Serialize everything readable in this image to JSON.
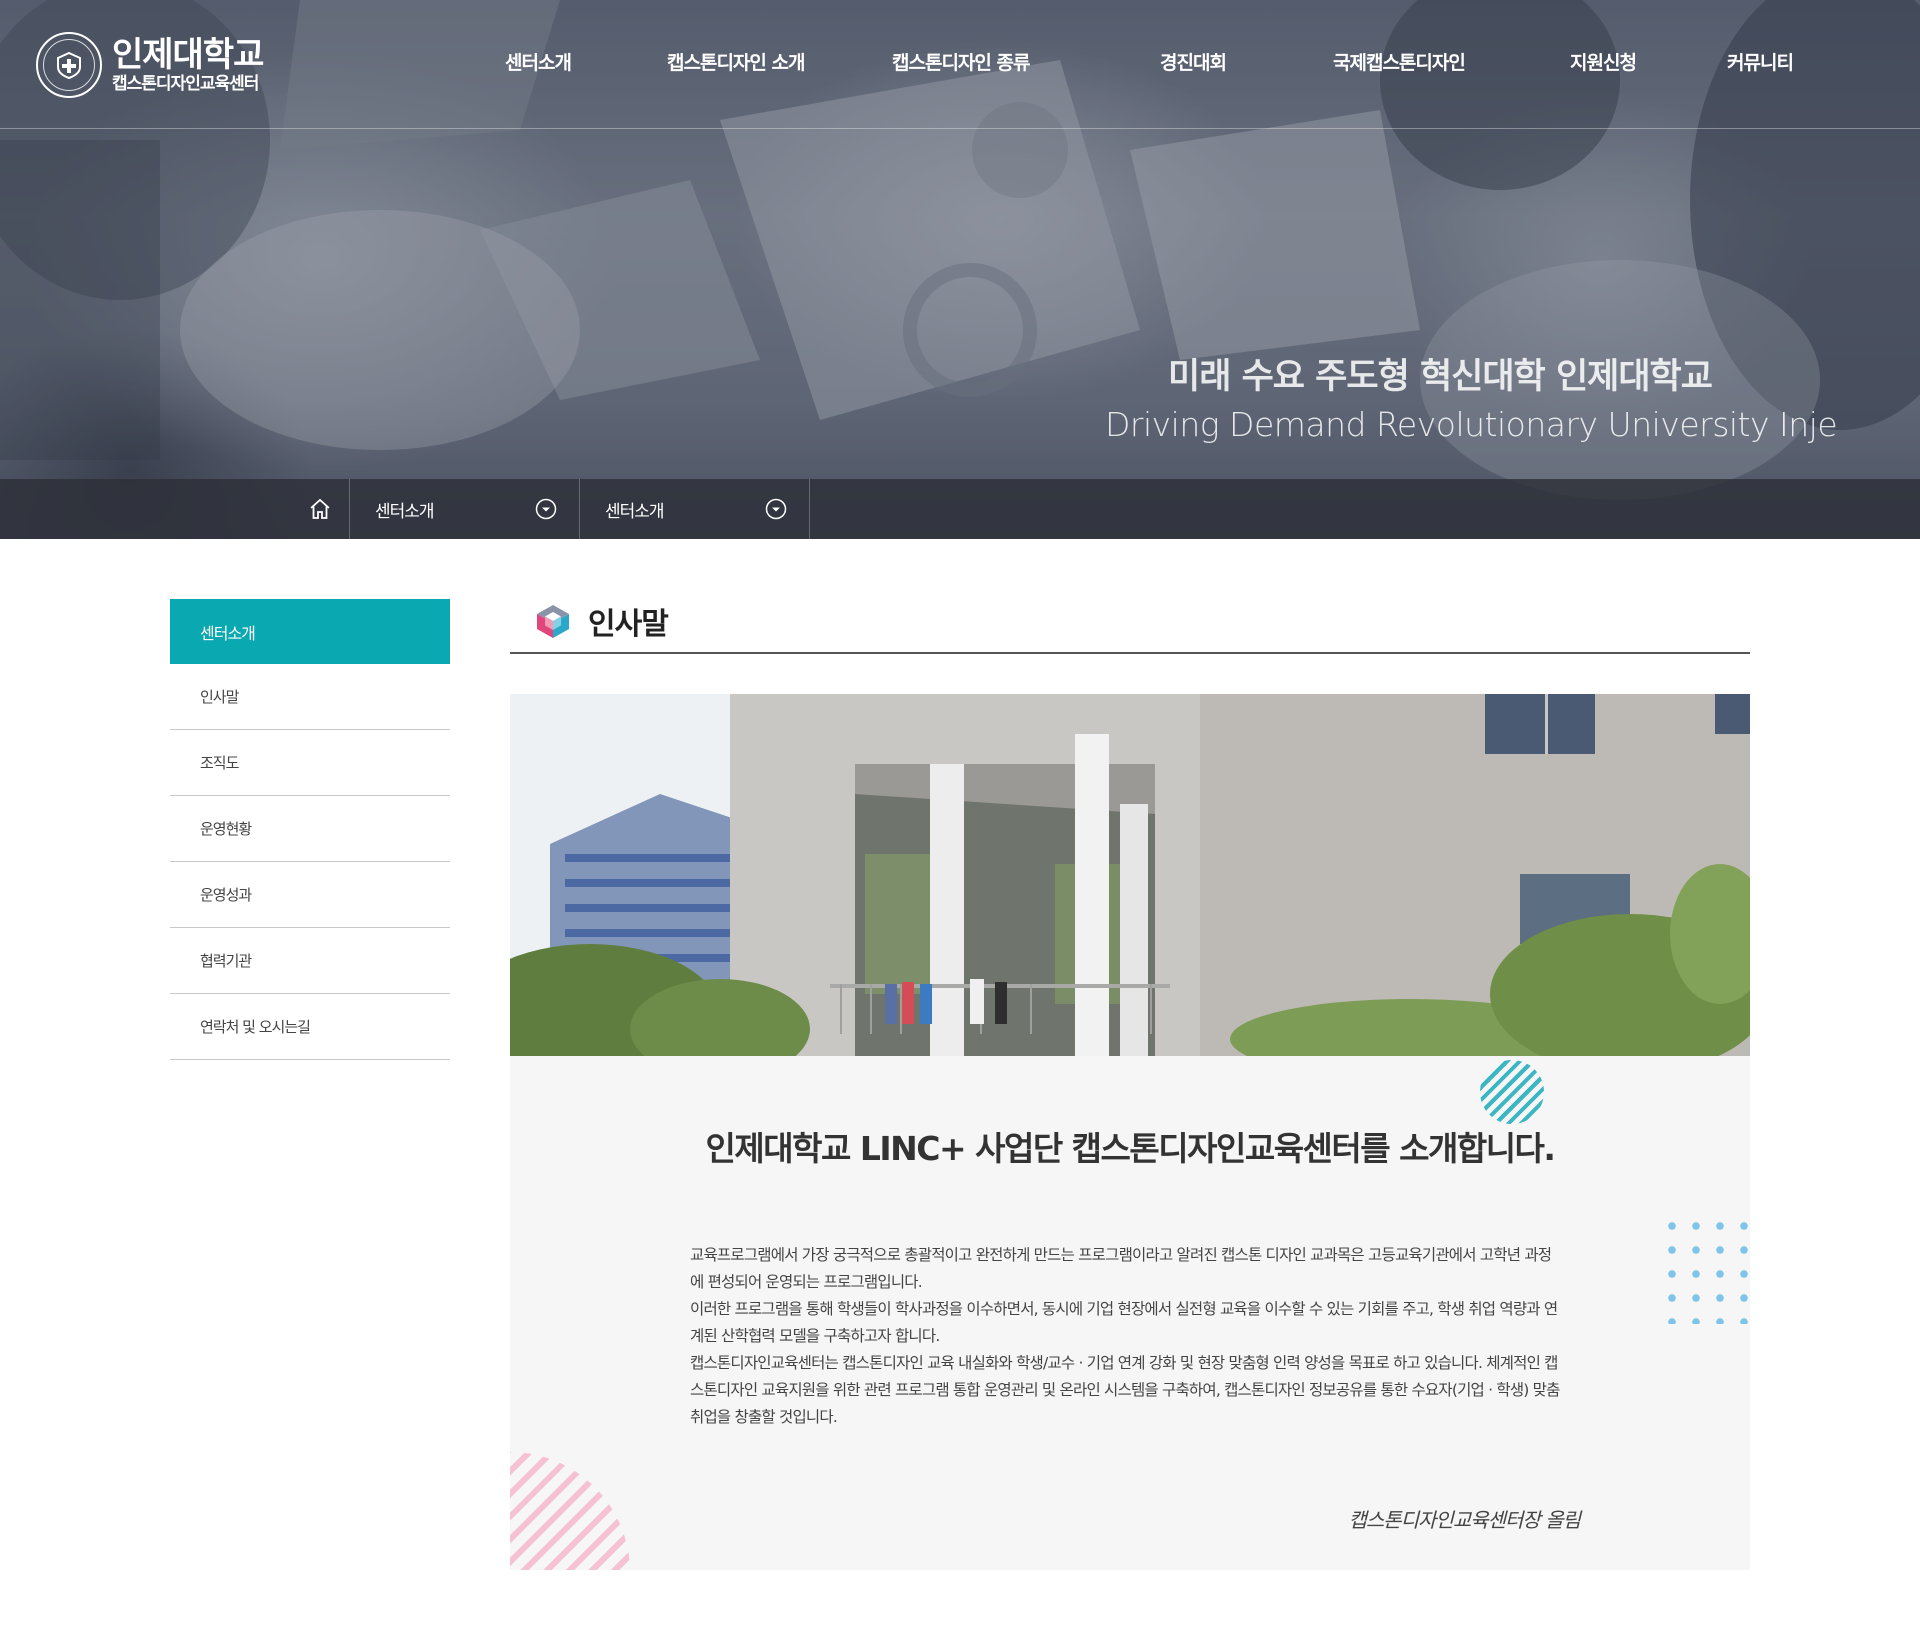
{
  "logo": {
    "title": "인제대학교",
    "subtitle": "캡스톤디자인교육센터"
  },
  "gnb": [
    {
      "label": "센터소개"
    },
    {
      "label": "캡스톤디자인 소개"
    },
    {
      "label": "캡스톤디자인 종류"
    },
    {
      "label": "경진대회"
    },
    {
      "label": "국제캡스톤디자인"
    },
    {
      "label": "지원신청"
    },
    {
      "label": "커뮤니티"
    }
  ],
  "hero": {
    "slogan_ko": "미래 수요 주도형 혁신대학 인제대학교",
    "slogan_en": "Driving Demand Revolutionary University Inje"
  },
  "breadcrumb": {
    "home_icon": "home-icon",
    "depth1": "센터소개",
    "depth2": "센터소개",
    "dropdown_icon": "chevron-down-circle-icon"
  },
  "sidebar": {
    "heading": "센터소개",
    "items": [
      {
        "label": "인사말"
      },
      {
        "label": "조직도"
      },
      {
        "label": "운영현황"
      },
      {
        "label": "운영성과"
      },
      {
        "label": "협력기관"
      },
      {
        "label": "연락처 및 오시는길"
      }
    ],
    "accent_color": "#0aa8b1"
  },
  "content": {
    "page_title": "인사말",
    "intro_heading": "인제대학교 LINC+ 사업단 캡스톤디자인교육센터를 소개합니다.",
    "paragraphs": [
      "교육프로그램에서 가장 궁극적으로 총괄적이고 완전하게 만드는 프로그램이라고 알려진 캡스톤 디자인 교과목은 고등교육기관에서 고학년 과정에 편성되어 운영되는 프로그램입니다.",
      "이러한 프로그램을 통해 학생들이 학사과정을 이수하면서, 동시에 기업 현장에서 실전형 교육을 이수할 수 있는 기회를 주고, 학생 취업 역량과 연계된 산학협력 모델을 구축하고자 합니다.",
      "캡스톤디자인교육센터는 캡스톤디자인 교육 내실화와 학생/교수 · 기업 연계 강화 및 현장 맞춤형 인력 양성을 목표로 하고 있습니다. 체계적인 캡스톤디자인 교육지원을 위한 관련 프로그램 통합 운영관리 및 온라인 시스템을 구축하여, 캡스톤디자인 정보공유를 통한 수요자(기업 · 학생) 맞춤취업을 창출할 것입니다."
    ],
    "signature": "캡스톤디자인교육센터장 올림"
  }
}
